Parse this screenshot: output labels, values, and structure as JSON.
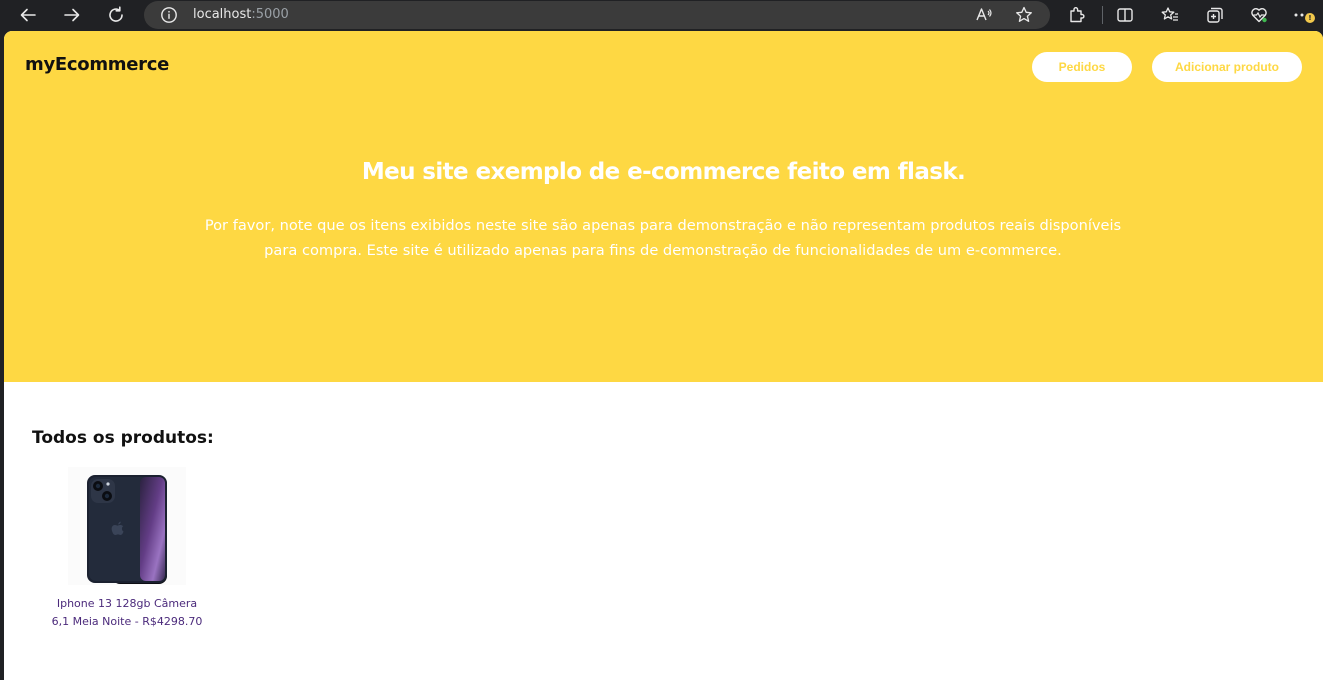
{
  "browser": {
    "url_host": "localhost",
    "url_port": ":5000",
    "alert_badge": "!"
  },
  "site": {
    "brand": "myEcommerce",
    "nav": {
      "orders_label": "Pedidos",
      "add_product_label": "Adicionar produto"
    },
    "hero": {
      "title": "Meu site exemplo de e-commerce feito em flask.",
      "description": "Por favor, note que os itens exibidos neste site são apenas para demonstração e não representam produtos reais disponíveis para compra. Este site é utilizado apenas para fins de demonstração de funcionalidades de um e-commerce."
    },
    "products_section": {
      "title": "Todos os produtos:",
      "products": [
        {
          "name": "Iphone 13 128gb Câmera 6,1 Meia Noite - R$4298.70",
          "icon": "smartphone-image"
        }
      ]
    }
  },
  "colors": {
    "hero_background": "#fed843",
    "button_text": "#fed843",
    "product_link": "#4b2a7b",
    "browser_chrome": "#202124"
  }
}
